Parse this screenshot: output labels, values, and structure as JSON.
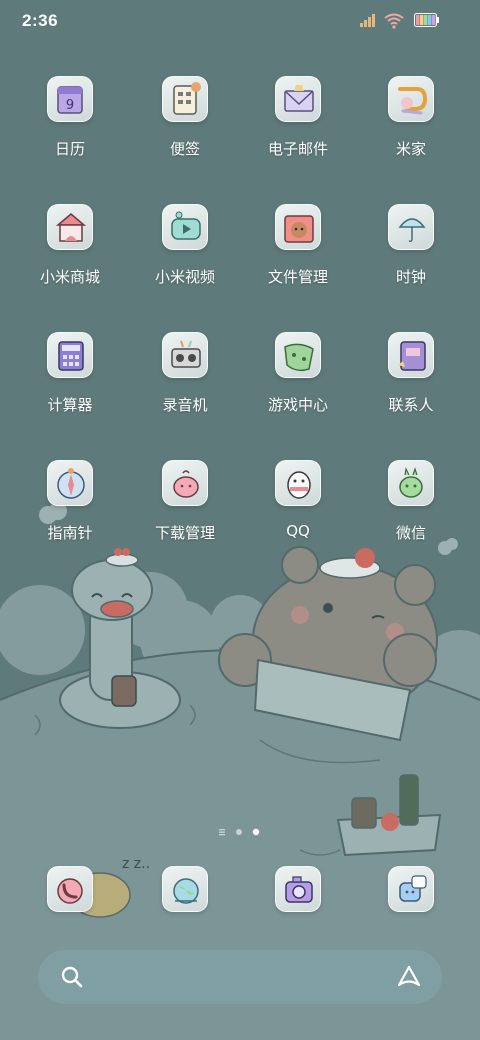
{
  "status_bar": {
    "time": "2:36"
  },
  "apps": [
    {
      "label": "日历",
      "icon": "calendar-icon",
      "day": "9"
    },
    {
      "label": "便签",
      "icon": "notes-icon"
    },
    {
      "label": "电子邮件",
      "icon": "email-icon"
    },
    {
      "label": "米家",
      "icon": "mijia-icon"
    },
    {
      "label": "小米商城",
      "icon": "mi-store-icon"
    },
    {
      "label": "小米视频",
      "icon": "mi-video-icon"
    },
    {
      "label": "文件管理",
      "icon": "file-manager-icon"
    },
    {
      "label": "时钟",
      "icon": "clock-icon"
    },
    {
      "label": "计算器",
      "icon": "calculator-icon"
    },
    {
      "label": "录音机",
      "icon": "recorder-icon"
    },
    {
      "label": "游戏中心",
      "icon": "game-center-icon"
    },
    {
      "label": "联系人",
      "icon": "contacts-icon"
    },
    {
      "label": "指南针",
      "icon": "compass-icon"
    },
    {
      "label": "下载管理",
      "icon": "download-manager-icon"
    },
    {
      "label": "QQ",
      "icon": "qq-icon"
    },
    {
      "label": "微信",
      "icon": "wechat-icon"
    }
  ],
  "dock": [
    {
      "icon": "phone-icon"
    },
    {
      "icon": "browser-icon"
    },
    {
      "icon": "camera-icon"
    },
    {
      "icon": "messages-icon"
    }
  ],
  "page_indicator": {
    "current": 2,
    "total": 2
  },
  "colors": {
    "background": "#5f7a7a",
    "search_bar": "#7f9fa3",
    "icon_tile": "#e3eaea"
  }
}
